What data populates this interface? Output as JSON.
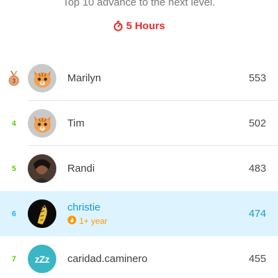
{
  "header": {
    "subtitle": "Top 10 advance to the next level.",
    "timer_label": "5 Hours",
    "timer_icon": "stopwatch-icon",
    "timer_color": "#ea2b2b"
  },
  "rows": [
    {
      "rank": "3",
      "medal": "bronze-medal-icon",
      "avatar": "cat-avatar",
      "name": "Marilyn",
      "xp": "553"
    },
    {
      "rank": "4",
      "avatar": "cat-avatar",
      "name": "Tim",
      "xp": "502"
    },
    {
      "rank": "5",
      "avatar": "photo-avatar",
      "name": "Randi",
      "xp": "483"
    },
    {
      "rank": "6",
      "avatar": "photo-avatar",
      "name": "christie",
      "xp": "474",
      "current_user": true,
      "streak": "1+ year",
      "streak_icon": "streak-flame-icon"
    },
    {
      "rank": "7",
      "avatar": "zzz-avatar",
      "avatar_text": "zZz",
      "name": "caridad.caminero",
      "xp": "455"
    }
  ],
  "colors": {
    "rank": "#58cc02",
    "current_row_bg": "#ddf4ff",
    "current_text": "#1899d6",
    "streak": "#ff9600"
  }
}
